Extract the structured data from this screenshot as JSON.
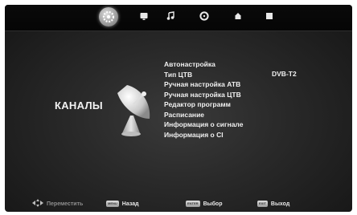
{
  "tabs": [
    {
      "id": "channel",
      "icon": "gear-icon",
      "active": true
    },
    {
      "id": "picture",
      "icon": "monitor-icon",
      "active": false
    },
    {
      "id": "sound",
      "icon": "music-note-icon",
      "active": false
    },
    {
      "id": "time",
      "icon": "clock-icon",
      "active": false
    },
    {
      "id": "lock",
      "icon": "lock-icon",
      "active": false
    },
    {
      "id": "setup",
      "icon": "square-icon",
      "active": false
    }
  ],
  "section": {
    "title": "КАНАЛЫ",
    "icon": "satellite-dish-icon"
  },
  "menu": {
    "items": [
      {
        "label": "Автонастройка"
      },
      {
        "label": "Тип ЦТВ",
        "value": "DVB-T2"
      },
      {
        "label": "Ручная настройка АТВ"
      },
      {
        "label": "Ручная настройка ЦТВ"
      },
      {
        "label": "Редактор программ"
      },
      {
        "label": "Расписание"
      },
      {
        "label": "Информация о сигнале"
      },
      {
        "label": "Информация о CI"
      }
    ]
  },
  "footer": {
    "move": {
      "label": "Переместить"
    },
    "back": {
      "key": "MENU",
      "label": "Назад"
    },
    "select": {
      "key": "ENTER",
      "label": "Выбор"
    },
    "exit": {
      "key": "EXIT",
      "label": "Выход"
    }
  }
}
